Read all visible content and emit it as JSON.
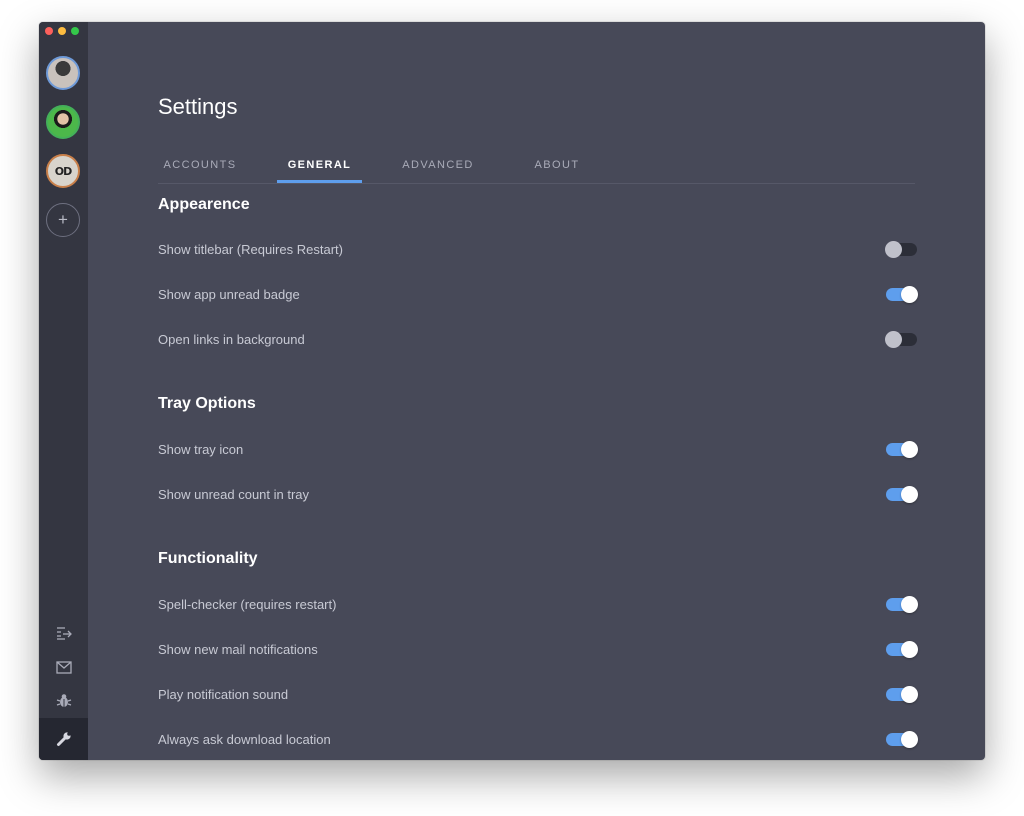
{
  "page": {
    "title": "Settings"
  },
  "tabs": [
    {
      "label": "ACCOUNTS",
      "active": false
    },
    {
      "label": "GENERAL",
      "active": true
    },
    {
      "label": "ADVANCED",
      "active": false
    },
    {
      "label": "ABOUT",
      "active": false
    }
  ],
  "sidebar": {
    "add_label": "+",
    "account3_glyph": "OD",
    "bottom_icons": [
      "list-arrow-icon",
      "mail-icon",
      "bug-icon",
      "wrench-icon"
    ]
  },
  "sections": [
    {
      "heading": "Appearence",
      "items": [
        {
          "label": "Show titlebar (Requires Restart)",
          "on": false
        },
        {
          "label": "Show app unread badge",
          "on": true
        },
        {
          "label": "Open links in background",
          "on": false
        }
      ]
    },
    {
      "heading": "Tray Options",
      "items": [
        {
          "label": "Show tray icon",
          "on": true
        },
        {
          "label": "Show unread count in tray",
          "on": true
        }
      ]
    },
    {
      "heading": "Functionality",
      "items": [
        {
          "label": "Spell-checker (requires restart)",
          "on": true
        },
        {
          "label": "Show new mail notifications",
          "on": true
        },
        {
          "label": "Play notification sound",
          "on": true
        },
        {
          "label": "Always ask download location",
          "on": true
        }
      ]
    }
  ],
  "colors": {
    "background": "#474958",
    "sidebar": "#343641",
    "accent": "#5e9eed"
  }
}
